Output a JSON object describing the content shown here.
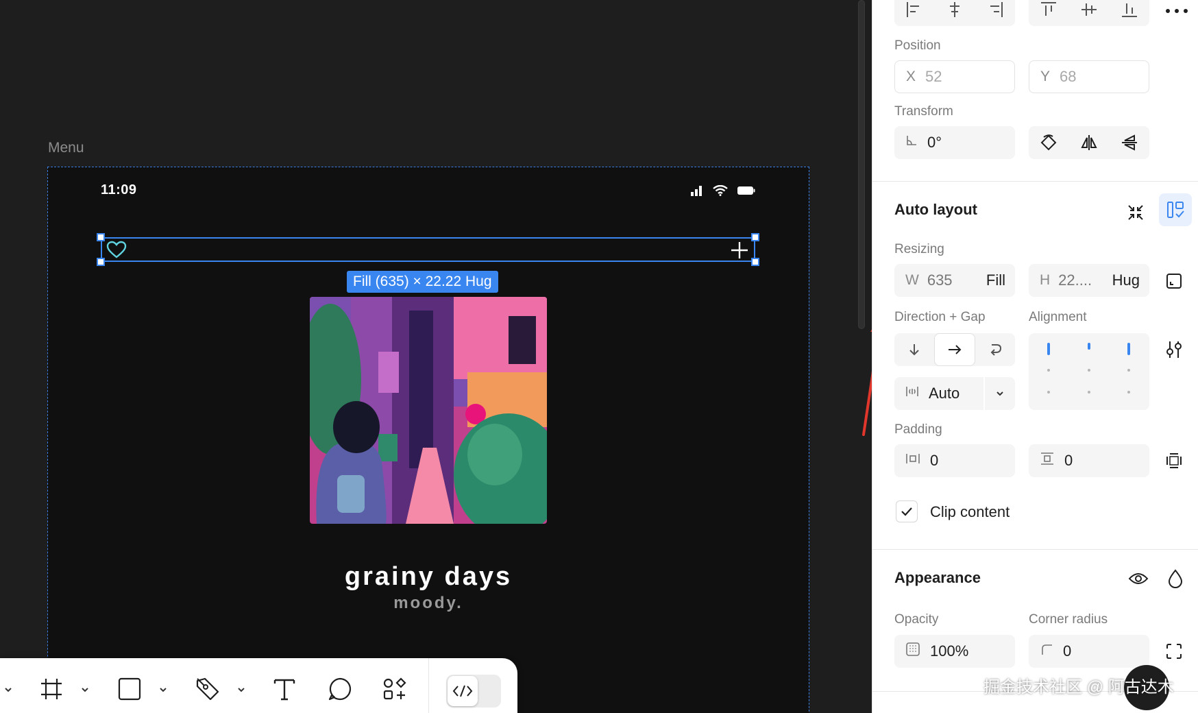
{
  "canvas": {
    "frame_label": "Menu",
    "status_time": "11:09",
    "selection_size": "Fill (635) × 22.22 Hug",
    "song_title": "grainy days",
    "song_artist": "moody."
  },
  "toolbar": {
    "tools": [
      "frame-tool",
      "rectangle-tool",
      "pen-tool",
      "text-tool",
      "comment-tool",
      "actions-tool",
      "dev-mode-toggle"
    ]
  },
  "panel": {
    "position": {
      "label": "Position",
      "x_prefix": "X",
      "x_value": "52",
      "y_prefix": "Y",
      "y_value": "68"
    },
    "transform": {
      "label": "Transform",
      "rotation": "0°"
    },
    "auto_layout": {
      "title": "Auto layout",
      "resizing_label": "Resizing",
      "w_prefix": "W",
      "w_value": "635",
      "w_mode": "Fill",
      "h_prefix": "H",
      "h_value": "22....",
      "h_mode": "Hug",
      "direction_label": "Direction + Gap",
      "alignment_label": "Alignment",
      "gap_value": "Auto",
      "padding_label": "Padding",
      "padding_h": "0",
      "padding_v": "0",
      "clip_content": "Clip content"
    },
    "appearance": {
      "title": "Appearance",
      "opacity_label": "Opacity",
      "opacity_value": "100%",
      "radius_label": "Corner radius",
      "radius_value": "0"
    }
  },
  "watermark": "掘金技术社区 @ 阿古达木",
  "colors": {
    "selection": "#3a86f0",
    "annotation_arrow": "#e0362c",
    "canvas_bg": "#1e1e1e"
  }
}
